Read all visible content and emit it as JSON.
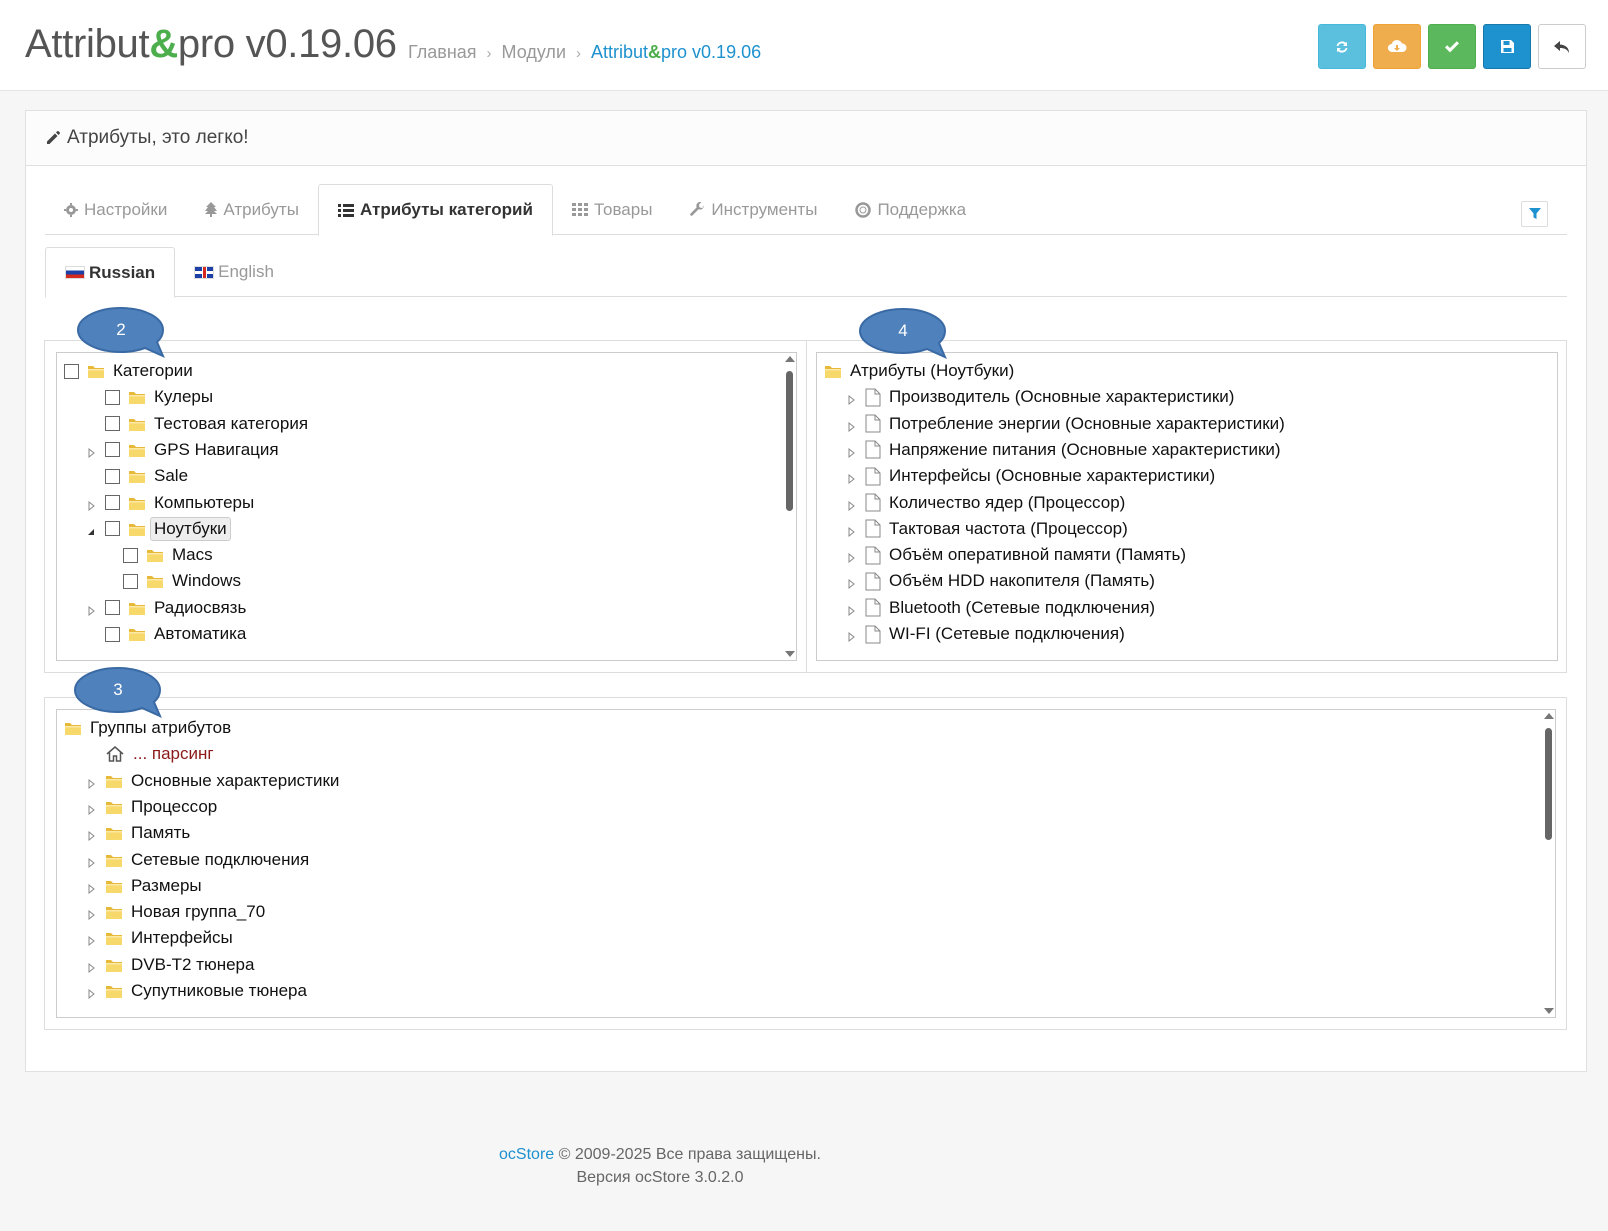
{
  "header": {
    "title_prefix": "Attribut",
    "title_amp": "&",
    "title_suffix": "pro v0.19.06",
    "breadcrumb": [
      {
        "label": "Главная"
      },
      {
        "label": "Модули"
      }
    ],
    "breadcrumb_active_prefix": "Attribut",
    "breadcrumb_active_amp": "&",
    "breadcrumb_active_suffix": "pro v0.19.06"
  },
  "toolbar": {
    "buttons": [
      {
        "name": "refresh",
        "icon": "refresh-icon",
        "color": "#5bc0de"
      },
      {
        "name": "cloud-download",
        "icon": "cloud-download-icon",
        "color": "#f0ad4e"
      },
      {
        "name": "check",
        "icon": "check-icon",
        "color": "#5cb85c"
      },
      {
        "name": "save",
        "icon": "floppy-icon",
        "color": "#1e91cf"
      },
      {
        "name": "back",
        "icon": "reply-icon",
        "color": "#ffffff"
      }
    ]
  },
  "panel": {
    "heading": "Атрибуты, это легко!",
    "tabs": [
      {
        "label": "Настройки",
        "icon": "gear-icon"
      },
      {
        "label": "Атрибуты",
        "icon": "tree-icon"
      },
      {
        "label": "Атрибуты категорий",
        "icon": "list-icon",
        "active": true
      },
      {
        "label": "Товары",
        "icon": "grid-icon"
      },
      {
        "label": "Инструменты",
        "icon": "wrench-icon"
      },
      {
        "label": "Поддержка",
        "icon": "lifebuoy-icon"
      }
    ],
    "lang_tabs": [
      {
        "label": "Russian",
        "active": true
      },
      {
        "label": "English"
      }
    ]
  },
  "bubbles": {
    "categories": "2",
    "groups": "3",
    "attributes": "4"
  },
  "categories_tree": {
    "root": "Категории",
    "items": [
      {
        "label": "Кулеры",
        "expander": "none",
        "depth": 1
      },
      {
        "label": "Тестовая категория",
        "expander": "none",
        "depth": 1
      },
      {
        "label": "GPS Навигация",
        "expander": "closed",
        "depth": 1
      },
      {
        "label": "Sale",
        "expander": "none",
        "depth": 1
      },
      {
        "label": "Компьютеры",
        "expander": "closed",
        "depth": 1
      },
      {
        "label": "Ноутбуки",
        "expander": "open",
        "depth": 1,
        "selected": true
      },
      {
        "label": "Macs",
        "expander": "none",
        "depth": 2
      },
      {
        "label": "Windows",
        "expander": "none",
        "depth": 2
      },
      {
        "label": "Радиосвязь",
        "expander": "closed",
        "depth": 1
      },
      {
        "label": "Автоматика",
        "expander": "none",
        "depth": 1
      }
    ]
  },
  "attributes_tree": {
    "root": "Атрибуты (Ноутбуки)",
    "items": [
      "Производитель (Основные характеристики)",
      "Потребление энергии (Основные характеристики)",
      "Напряжение питания (Основные характеристики)",
      "Интерфейсы (Основные характеристики)",
      "Количество ядер (Процессор)",
      "Тактовая частота (Процессор)",
      "Объём оперативной памяти (Память)",
      "Объём HDD накопителя (Память)",
      "Bluetooth (Сетевые подключения)",
      "WI-FI (Сетевые подключения)"
    ]
  },
  "groups_tree": {
    "root": "Группы атрибутов",
    "parsing": "... парсинг",
    "items": [
      "Основные характеристики",
      "Процессор",
      "Память",
      "Сетевые подключения",
      "Размеры",
      "Новая группа_70",
      "Интерфейсы",
      "DVB-T2 тюнера",
      "Супутниковые тюнера"
    ]
  },
  "footer": {
    "brand": "ocStore",
    "copyright": "© 2009-2025 Все права защищены.",
    "version": "Версия ocStore 3.0.2.0"
  }
}
